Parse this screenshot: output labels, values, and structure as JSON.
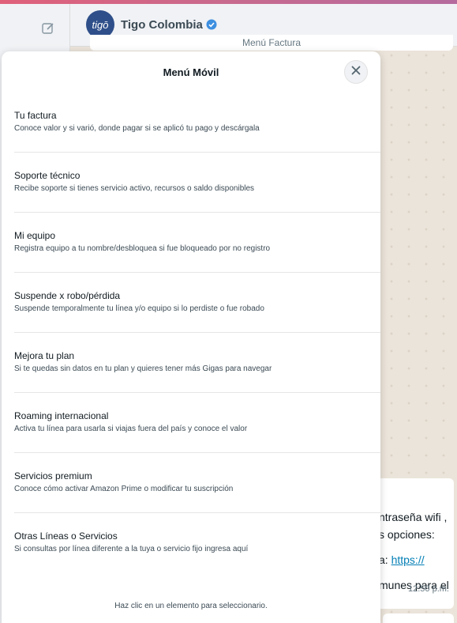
{
  "background": {
    "contact": {
      "avatar_text": "tigō",
      "name": "Tigo Colombia"
    },
    "pinned_text": "Menú Factura",
    "bubble": {
      "line1": "ntraseña wifi ,",
      "line2": "s opciones:",
      "line3_prefix": "a: ",
      "line3_link": "https://",
      "line4": "munes para el",
      "time": "12:50 p.m."
    }
  },
  "modal": {
    "title": "Menú Móvil",
    "items": [
      {
        "title": "Tu factura",
        "description": "Conoce valor y si varió, donde pagar si se aplicó tu pago y descárgala"
      },
      {
        "title": "Soporte técnico",
        "description": "Recibe soporte si tienes servicio activo, recursos o saldo disponibles"
      },
      {
        "title": "Mi equipo",
        "description": "Registra equipo a tu nombre/desbloquea si fue bloqueado por no registro"
      },
      {
        "title": "Suspende x robo/pérdida",
        "description": "Suspende temporalmente tu línea y/o equipo si lo perdiste o fue robado"
      },
      {
        "title": "Mejora tu plan",
        "description": "Si te quedas sin datos en tu plan y quieres tener más Gigas para navegar"
      },
      {
        "title": "Roaming internacional",
        "description": "Activa tu línea para usarla si viajas fuera del país y conoce el valor"
      },
      {
        "title": "Servicios premium",
        "description": "Conoce cómo activar Amazon Prime o modificar tu suscripción"
      },
      {
        "title": "Otras Líneas o Servicios",
        "description": "Si consultas por línea diferente a la tuya o servicio fijo ingresa aquí"
      }
    ],
    "footer": "Haz clic en un elemento para seleccionario."
  }
}
